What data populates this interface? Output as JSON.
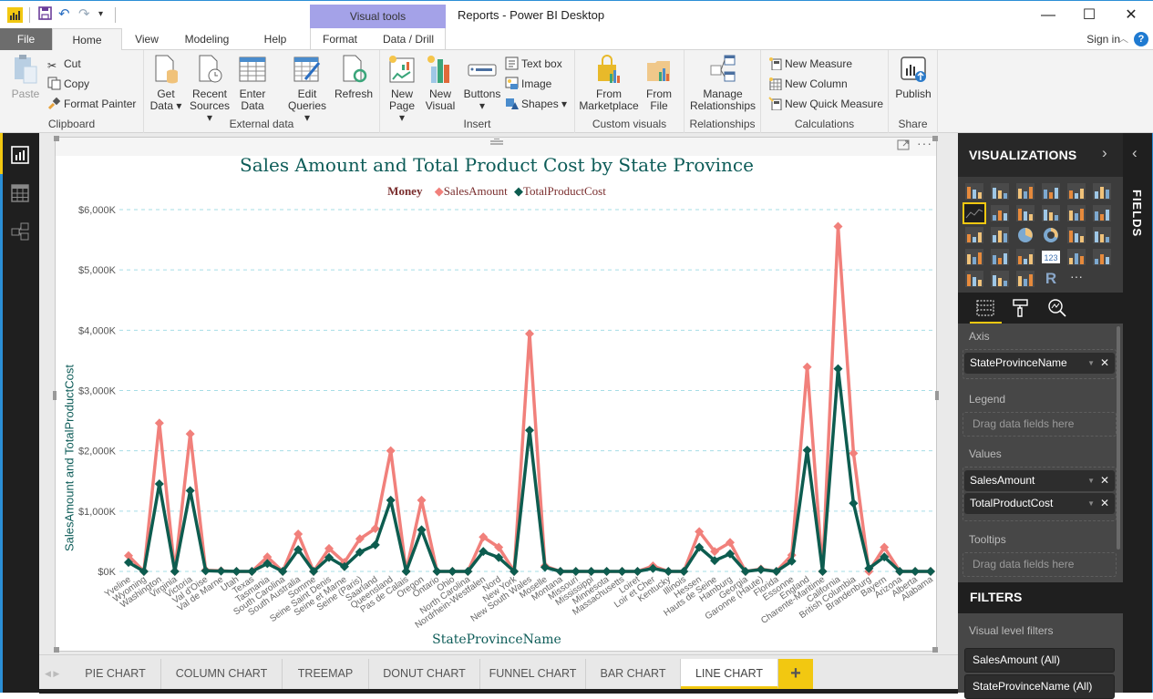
{
  "window": {
    "title": "Reports - Power BI Desktop",
    "context_group": "Visual tools",
    "controls": {
      "minimize": "—",
      "maximize": "☐",
      "close": "✕"
    }
  },
  "tabs": {
    "file": "File",
    "items": [
      "Home",
      "View",
      "Modeling",
      "Help"
    ],
    "context_items": [
      "Format",
      "Data / Drill"
    ],
    "active": "Home",
    "sign_in": "Sign in",
    "help": "?"
  },
  "ribbon": {
    "clipboard": {
      "label": "Clipboard",
      "paste": "Paste",
      "cut": "Cut",
      "copy": "Copy",
      "format_painter": "Format Painter"
    },
    "external_data": {
      "label": "External data",
      "get_data": [
        "Get",
        "Data ▾"
      ],
      "recent_sources": [
        "Recent",
        "Sources ▾"
      ],
      "enter_data": [
        "Enter",
        "Data"
      ],
      "edit_queries": [
        "Edit",
        "Queries ▾"
      ],
      "refresh": "Refresh"
    },
    "insert": {
      "label": "Insert",
      "new_page": [
        "New",
        "Page ▾"
      ],
      "new_visual": [
        "New",
        "Visual"
      ],
      "buttons": [
        "Buttons",
        "▾"
      ],
      "text_box": "Text box",
      "image": "Image",
      "shapes": "Shapes ▾"
    },
    "custom_visuals": {
      "label": "Custom visuals",
      "from_marketplace": [
        "From",
        "Marketplace"
      ],
      "from_file": [
        "From",
        "File"
      ]
    },
    "relationships": {
      "label": "Relationships",
      "manage": [
        "Manage",
        "Relationships"
      ]
    },
    "calculations": {
      "label": "Calculations",
      "new_measure": "New Measure",
      "new_column": "New Column",
      "new_quick_measure": "New Quick Measure"
    },
    "share": {
      "label": "Share",
      "publish": "Publish"
    }
  },
  "page_tabs": {
    "items": [
      "PIE CHART",
      "COLUMN CHART",
      "TREEMAP",
      "DONUT CHART",
      "FUNNEL CHART",
      "BAR CHART",
      "LINE CHART"
    ],
    "active": "LINE CHART",
    "add": "+"
  },
  "visualizations": {
    "title": "VISUALIZATIONS",
    "fields_label": "FIELDS",
    "wells": {
      "axis_label": "Axis",
      "axis_field": "StateProvinceName",
      "legend_label": "Legend",
      "legend_placeholder": "Drag data fields here",
      "values_label": "Values",
      "values_fields": [
        "SalesAmount",
        "TotalProductCost"
      ],
      "tooltips_label": "Tooltips",
      "tooltips_placeholder": "Drag data fields here"
    },
    "filters": {
      "title": "FILTERS",
      "section": "Visual level filters",
      "items": [
        "SalesAmount  (All)",
        "StateProvinceName  (All)"
      ]
    }
  },
  "colors": {
    "sales": "#f1807b",
    "cost": "#0d5c4f",
    "gridline": "#a6dde6",
    "accent": "#f2c811"
  },
  "chart_data": {
    "type": "line",
    "title": "Sales Amount and Total Product Cost by State Province",
    "legend_title": "Money",
    "legend_position": "top-center",
    "xlabel": "StateProvinceName",
    "ylabel": "SalesAmount and TotalProductCost",
    "ylim": [
      0,
      6000
    ],
    "y_unit": "$K",
    "yticks": [
      "$0K",
      "$1,000K",
      "$2,000K",
      "$3,000K",
      "$4,000K",
      "$5,000K",
      "$6,000K"
    ],
    "grid": true,
    "categories": [
      "Yveline",
      "Wyoming",
      "Washington",
      "Virginia",
      "Victoria",
      "Val d'Oise",
      "Val de Marne",
      "Utah",
      "Texas",
      "Tasmania",
      "South Carolina",
      "South Australia",
      "Somme",
      "Seine Saint Denis",
      "Seine et Marne",
      "Seine (Paris)",
      "Saarland",
      "Queensland",
      "Pas de Calais",
      "Oregon",
      "Ontario",
      "Ohio",
      "North Carolina",
      "Nordrhein-Westfalen",
      "Nord",
      "New York",
      "New South Wales",
      "Moselle",
      "Montana",
      "Missouri",
      "Mississippi",
      "Minnesota",
      "Massachusetts",
      "Loiret",
      "Loir et Cher",
      "Kentucky",
      "Illinois",
      "Hessen",
      "Hauts de Seine",
      "Hamburg",
      "Georgia",
      "Garonne (Haute)",
      "Florida",
      "Essonne",
      "England",
      "Charente-Maritime",
      "California",
      "British Columbia",
      "Brandenburg",
      "Bayern",
      "Arizona",
      "Alberta",
      "Alabama"
    ],
    "series": [
      {
        "name": "SalesAmount",
        "values": [
          260,
          0,
          2460,
          0,
          2280,
          20,
          10,
          0,
          0,
          240,
          0,
          620,
          0,
          380,
          150,
          540,
          710,
          2000,
          0,
          1180,
          0,
          0,
          0,
          570,
          400,
          0,
          3940,
          90,
          0,
          0,
          0,
          0,
          0,
          0,
          90,
          0,
          0,
          660,
          330,
          480,
          0,
          40,
          0,
          270,
          3390,
          0,
          5720,
          1960,
          0,
          400,
          0,
          0,
          0
        ]
      },
      {
        "name": "TotalProductCost",
        "values": [
          150,
          0,
          1450,
          0,
          1340,
          10,
          5,
          0,
          0,
          130,
          0,
          360,
          0,
          230,
          80,
          320,
          440,
          1180,
          0,
          690,
          0,
          0,
          0,
          330,
          230,
          0,
          2340,
          70,
          0,
          0,
          0,
          0,
          0,
          0,
          50,
          0,
          0,
          400,
          180,
          290,
          0,
          30,
          0,
          170,
          2010,
          0,
          3360,
          1130,
          50,
          240,
          0,
          0,
          0
        ]
      }
    ]
  }
}
